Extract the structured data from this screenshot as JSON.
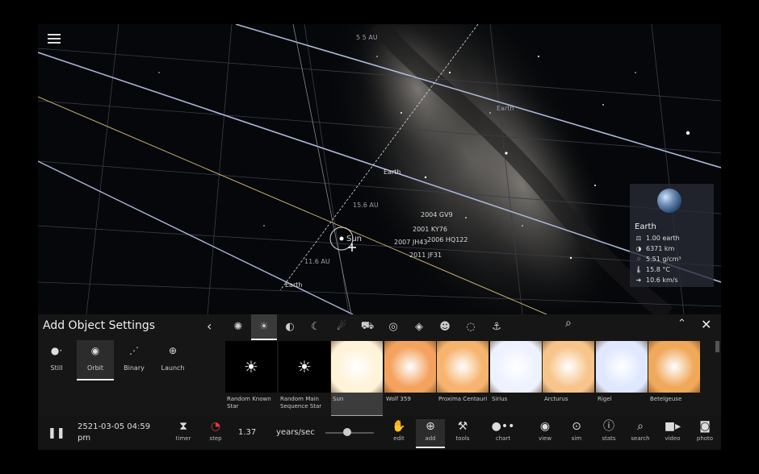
{
  "viewport": {
    "labels": {
      "au_top": "5 5 AU",
      "earth_upper": "Earth",
      "earth_mid": "Earth",
      "au_15": "15.6 AU",
      "sun": "Sun",
      "au_116": "11.6 AU",
      "earth_lower": "Earth",
      "gv9": "2004 GV9",
      "ky76": "2001 KY76",
      "jh43": "2007 JH43",
      "hq122": "2006 HQ122",
      "jf31": "2011 JF31"
    },
    "info_card": {
      "name": "Earth",
      "mass": "1.00 earth",
      "radius": "6371 km",
      "density": "5.51 g/cm³",
      "temperature": "15.8 °C",
      "velocity": "10.6 km/s"
    }
  },
  "add_panel": {
    "title": "Add Object Settings",
    "modes": [
      {
        "label": "Still",
        "icon": "dot-arrow-icon"
      },
      {
        "label": "Orbit",
        "icon": "orbit-icon"
      },
      {
        "label": "Binary",
        "icon": "binary-icon"
      },
      {
        "label": "Launch",
        "icon": "launch-icon"
      }
    ],
    "active_mode": "Orbit",
    "categories": [
      "nebula",
      "star",
      "planet",
      "moon",
      "comet",
      "spacecraft",
      "galaxy",
      "asteroid",
      "people",
      "blackhole",
      "anchor"
    ],
    "active_category": "star",
    "stars": [
      {
        "label": "Random Known Star",
        "color": "#ffffff"
      },
      {
        "label": "Random Main Sequence Star",
        "color": "#ffffff"
      },
      {
        "label": "Sun",
        "color": "#fff3d9"
      },
      {
        "label": "Wolf 359",
        "color": "#f4a35f"
      },
      {
        "label": "Proxima Centauri",
        "color": "#f6b46e"
      },
      {
        "label": "Sirius",
        "color": "#eef2ff"
      },
      {
        "label": "Arcturus",
        "color": "#f7c58c"
      },
      {
        "label": "Rigel",
        "color": "#dfe8ff"
      },
      {
        "label": "Betelgeuse",
        "color": "#f0a85a"
      }
    ],
    "selected_star": "Sun"
  },
  "toolbar": {
    "datetime": "2521-03-05 04:59 pm",
    "timer": "timer",
    "step": "step",
    "rate_value": "1.37",
    "rate_unit": "years/sec",
    "slider_level": 0.45,
    "buttons": [
      "edit",
      "add",
      "tools",
      "chart",
      "view",
      "sim",
      "stats",
      "search",
      "video",
      "photo"
    ],
    "active_button": "add"
  }
}
